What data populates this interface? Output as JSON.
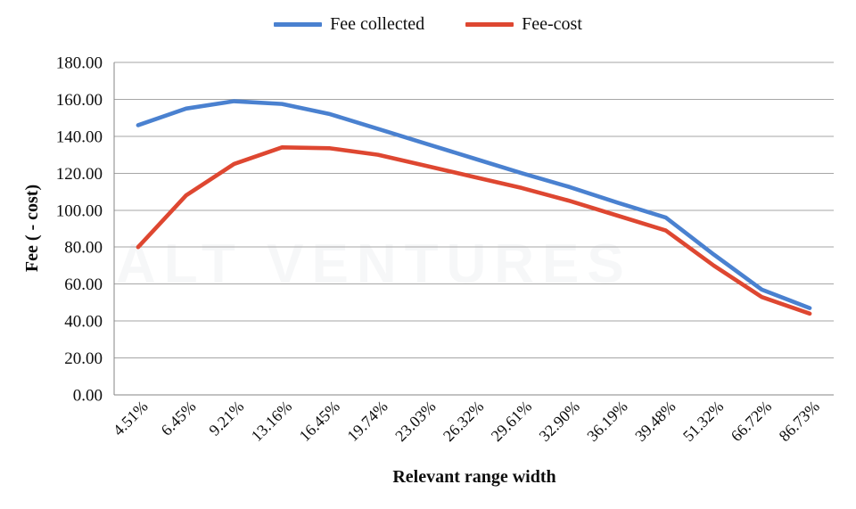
{
  "legend": {
    "position": "top-center",
    "entries": [
      {
        "label": "Fee collected",
        "color": "#4A81D0",
        "name": "fee-collected"
      },
      {
        "label": "Fee-cost",
        "color": "#DE4731",
        "name": "fee-cost"
      }
    ]
  },
  "axes": {
    "y_title": "Fee ( - cost)",
    "x_title": "Relevant range width",
    "y_ticks": [
      "0.00",
      "20.00",
      "40.00",
      "60.00",
      "80.00",
      "100.00",
      "120.00",
      "140.00",
      "160.00",
      "180.00"
    ]
  },
  "watermark": {
    "text": "ALT VENTURES"
  },
  "chart_data": {
    "type": "line",
    "title": "",
    "subtitle": "",
    "xlabel": "Relevant range width",
    "ylabel": "Fee ( - cost)",
    "ylim": [
      0,
      180
    ],
    "ytick_step": 20,
    "grid": true,
    "legend_position": "top-center",
    "categories": [
      "4.51%",
      "6.45%",
      "9.21%",
      "13.16%",
      "16.45%",
      "19.74%",
      "23.03%",
      "26.32%",
      "29.61%",
      "32.90%",
      "36.19%",
      "39.48%",
      "51.32%",
      "66.72%",
      "86.73%"
    ],
    "series": [
      {
        "name": "Fee collected",
        "color": "#4A81D0",
        "values": [
          146.0,
          155.0,
          159.0,
          157.5,
          152.0,
          144.0,
          136.0,
          128.0,
          120.0,
          112.5,
          104.0,
          96.0,
          76.0,
          57.0,
          47.0
        ]
      },
      {
        "name": "Fee-cost",
        "color": "#DE4731",
        "values": [
          80.0,
          108.0,
          125.0,
          134.0,
          133.5,
          130.0,
          124.0,
          118.0,
          112.0,
          105.0,
          97.0,
          89.0,
          70.0,
          53.0,
          44.0
        ]
      }
    ]
  }
}
